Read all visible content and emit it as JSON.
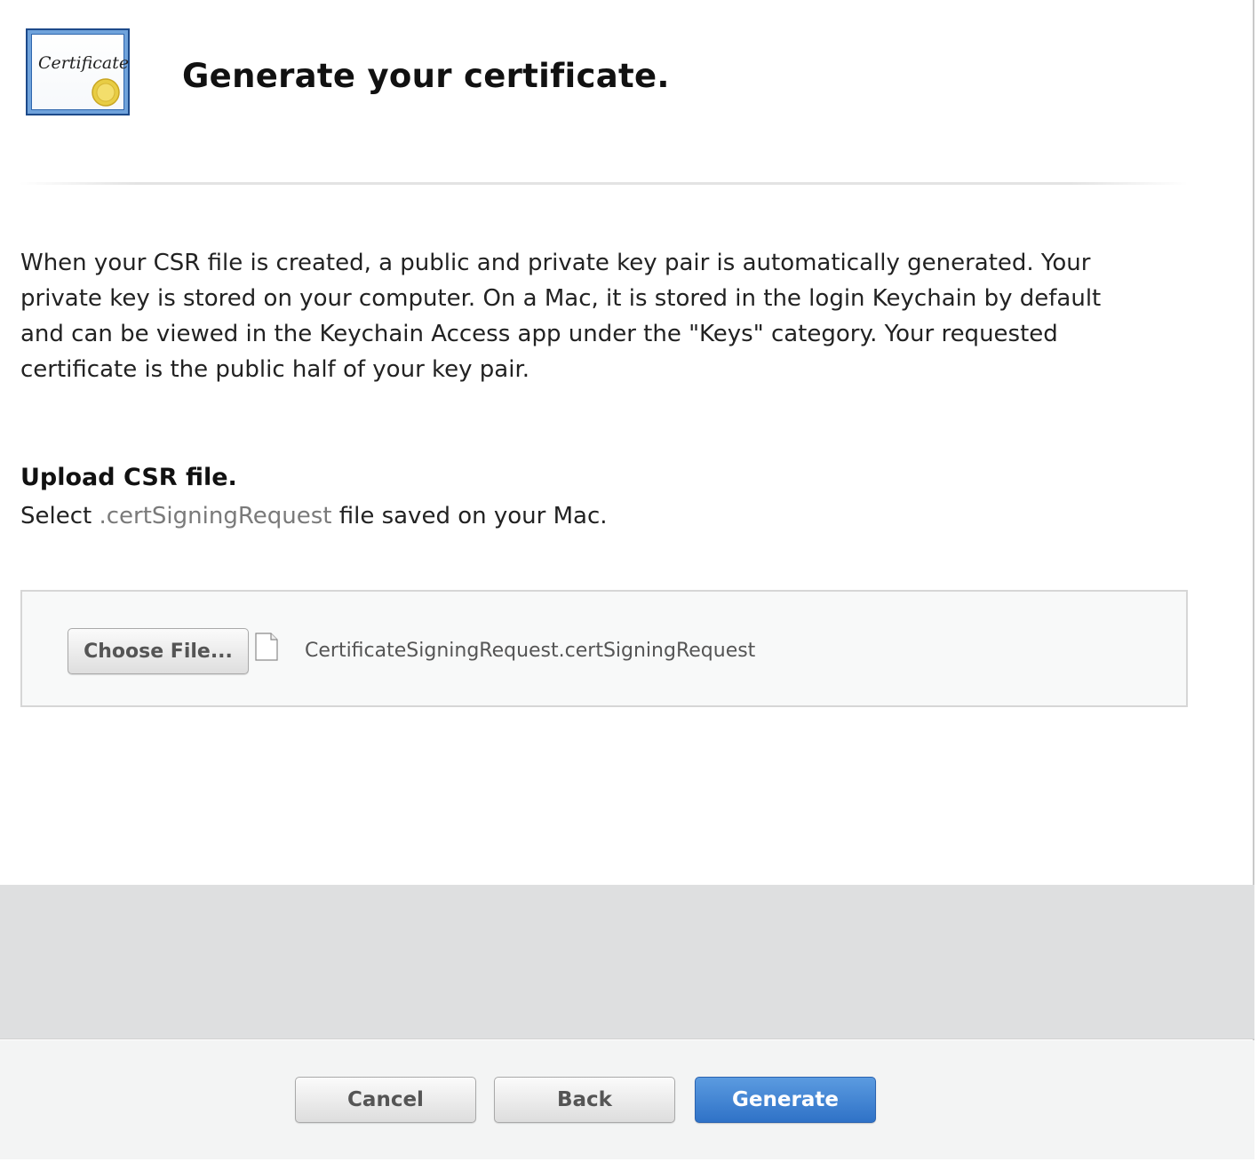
{
  "header": {
    "title": "Generate your certificate.",
    "icon_text": "Certificate",
    "icon": "certificate-icon"
  },
  "description": "When your CSR file is created, a public and private key pair is automatically generated. Your private key is stored on your computer. On a Mac, it is stored in the login Keychain by default and can be viewed in the Keychain Access app under the \"Keys\" category. Your requested certificate is the public half of your key pair.",
  "upload": {
    "heading": "Upload CSR file.",
    "instruction_prefix": "Select ",
    "instruction_ext": ".certSigningRequest",
    "instruction_suffix": " file saved on your Mac.",
    "choose_label": "Choose File...",
    "file_icon": "document-icon",
    "file_name": "CertificateSigningRequest.certSigningRequest"
  },
  "footer": {
    "cancel_label": "Cancel",
    "back_label": "Back",
    "generate_label": "Generate"
  },
  "colors": {
    "primary_button": "#3578cc",
    "icon_border": "#1d4a8a",
    "seal": "#e6c93a"
  }
}
